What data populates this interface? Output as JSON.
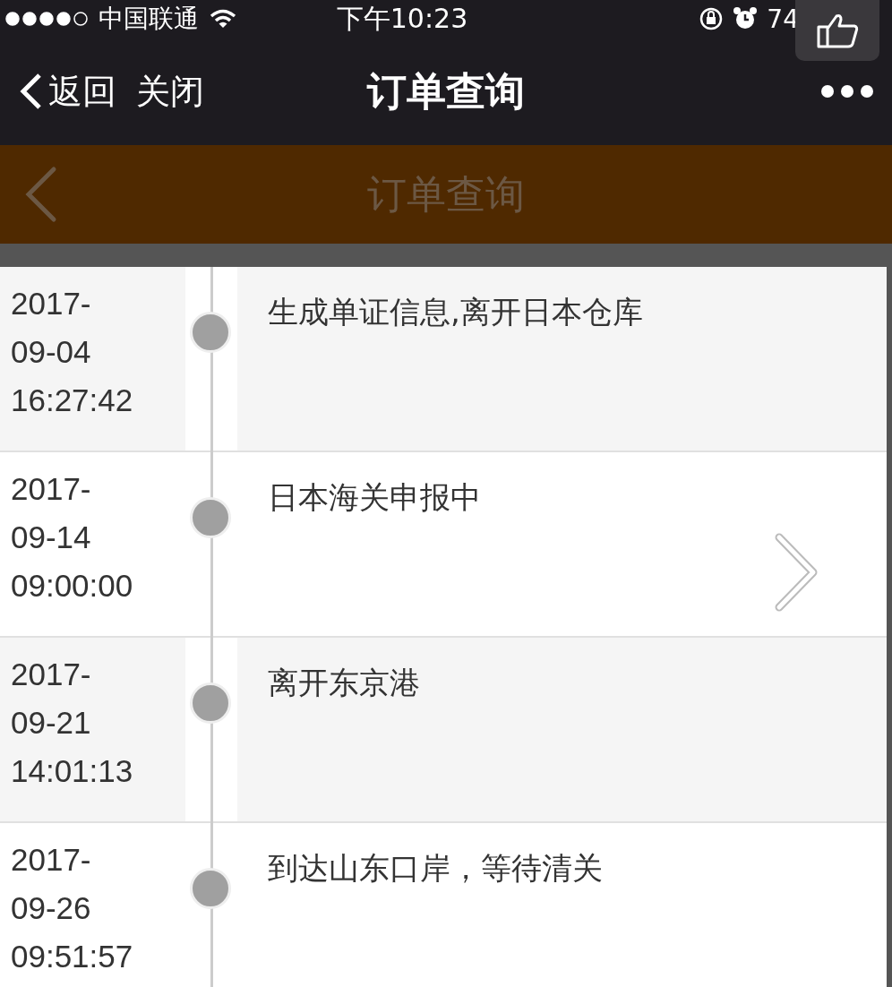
{
  "status_bar": {
    "carrier": "中国联通",
    "time": "下午10:23",
    "battery": "74"
  },
  "nav_bar": {
    "back": "返回",
    "close": "关闭",
    "title": "订单查询"
  },
  "page_header": {
    "title": "订单查询"
  },
  "timeline": [
    {
      "date_lines": [
        "2017-",
        "09-04",
        "16:27:42"
      ],
      "event": "生成单证信息,离开日本仓库"
    },
    {
      "date_lines": [
        "2017-",
        "09-14",
        "09:00:00"
      ],
      "event": "日本海关申报中"
    },
    {
      "date_lines": [
        "2017-",
        "09-21",
        "14:01:13"
      ],
      "event": "离开东京港"
    },
    {
      "date_lines": [
        "2017-",
        "09-26",
        "09:51:57"
      ],
      "event": "到达山东口岸，等待清关"
    }
  ]
}
